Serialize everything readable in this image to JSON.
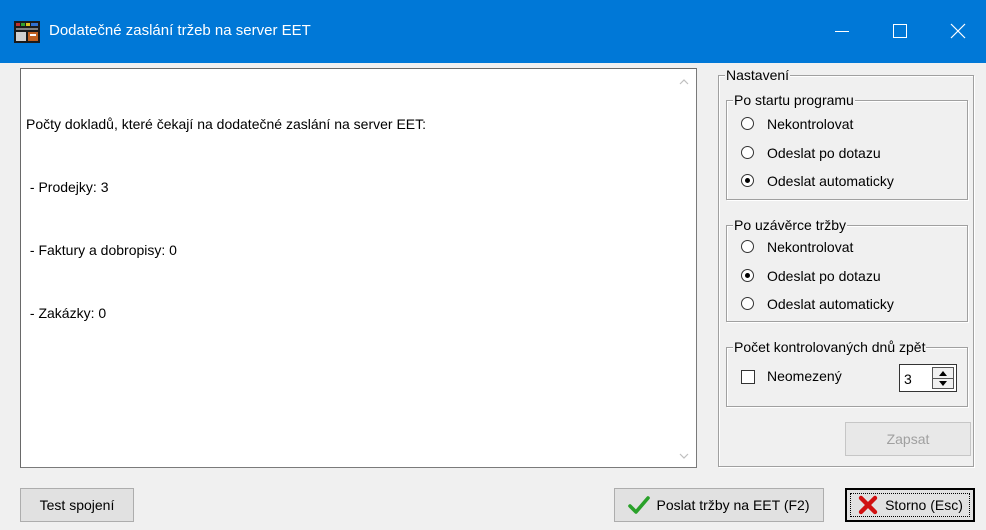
{
  "window": {
    "title": "Dodatečné zaslání tržeb na server EET",
    "colors": {
      "titlebar": "#0078d7",
      "accent_check": "#2aa12a",
      "cancel_x": "#d01010"
    }
  },
  "memo": {
    "lines": [
      "Počty dokladů, které čekají na dodatečné zaslání na server EET:",
      " - Prodejky: 3",
      " - Faktury a dobropisy: 0",
      " - Zakázky: 0"
    ]
  },
  "settings": {
    "label": "Nastavení",
    "after_start": {
      "label": "Po startu programu",
      "options": [
        "Nekontrolovat",
        "Odeslat po dotazu",
        "Odeslat automaticky"
      ],
      "selected": "Odeslat automaticky"
    },
    "after_close": {
      "label": "Po uzávěrce tržby",
      "options": [
        "Nekontrolovat",
        "Odeslat po dotazu",
        "Odeslat automaticky"
      ],
      "selected": "Odeslat po dotazu"
    },
    "days": {
      "label": "Počet kontrolovaných dnů zpět",
      "unlimited_label": "Neomezený",
      "unlimited_checked": false,
      "value": "3"
    },
    "save_label": "Zapsat"
  },
  "footer": {
    "test_label": "Test spojení",
    "send_label": "Poslat tržby na EET (F2)",
    "cancel_label": "Storno (Esc)"
  },
  "icons": {
    "app": "eet-app-icon",
    "send": "green-check-icon",
    "cancel": "red-x-icon"
  }
}
